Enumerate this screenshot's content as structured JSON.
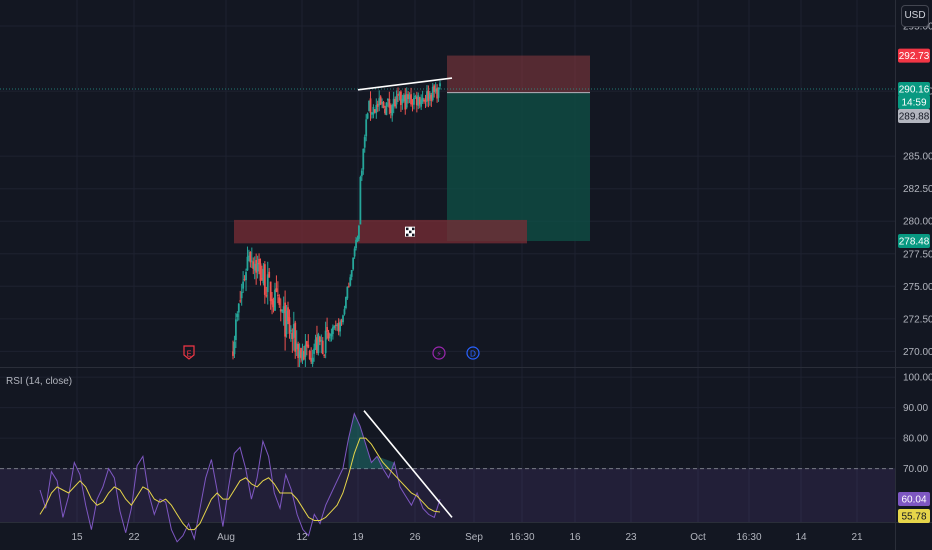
{
  "currency_button": "USD",
  "rsi_title": "RSI (14, close)",
  "colors": {
    "background": "#131722",
    "grid": "#1e2230",
    "up": "#26a69a",
    "down": "#ef5350",
    "rsi_line": "#7e57c2",
    "rsi_ma": "#e6d54a",
    "stop_zone": "#8c3a40",
    "target_zone": "#0f4d45",
    "resistance_zone": "#7a2e36"
  },
  "price_badges": {
    "stop": {
      "text": "292.73",
      "value": 292.73,
      "color": "#f23645"
    },
    "current": {
      "text": "290.16",
      "value": 290.16,
      "color": "#089981"
    },
    "countdown": {
      "text": "14:59",
      "color": "#089981"
    },
    "entry": {
      "text": "289.88",
      "value": 289.88,
      "color": "#b2b5be"
    },
    "target": {
      "text": "278.48",
      "value": 278.48,
      "color": "#089981"
    }
  },
  "rsi_badges": {
    "rsi": {
      "text": "60.04",
      "value": 60.04,
      "color": "#7e57c2"
    },
    "ma": {
      "text": "55.78",
      "value": 55.78,
      "color": "#e6d54a"
    }
  },
  "event_markers": [
    {
      "symbol": "E",
      "kind": "earnings",
      "color": "#f23645",
      "date": "Jul 31"
    },
    {
      "symbol": "⚡",
      "kind": "split",
      "color": "#9c27b0",
      "date": "Aug 26"
    },
    {
      "symbol": "D",
      "kind": "dividend",
      "color": "#2962ff",
      "date": "Aug 28"
    }
  ],
  "chart_data": [
    {
      "type": "candlestick",
      "ylim": [
        268.8,
        297.0
      ],
      "y_ticks": [
        "295.00",
        "290.00",
        "285.00",
        "282.50",
        "280.00",
        "277.50",
        "275.00",
        "272.50",
        "270.00"
      ],
      "y_tick_values": [
        295.0,
        290.0,
        285.0,
        282.5,
        280.0,
        277.5,
        275.0,
        272.5,
        270.0
      ],
      "x_ticks": [
        "15",
        "22",
        "Aug",
        "12",
        "19",
        "26",
        "Sep",
        "16:30",
        "16",
        "23",
        "Oct",
        "16:30",
        "14",
        "21"
      ],
      "segments": [
        {
          "start": 270.0,
          "end": 277.8,
          "low": 268.8,
          "high": 278.8,
          "vol": 1.0,
          "bars": 12
        },
        {
          "start": 277.8,
          "end": 269.8,
          "low": 268.8,
          "high": 279.0,
          "vol": 1.2,
          "bars": 36
        },
        {
          "start": 269.8,
          "end": 270.8,
          "low": 268.8,
          "high": 276.0,
          "vol": 1.0,
          "bars": 18
        },
        {
          "start": 270.8,
          "end": 272.2,
          "low": 268.8,
          "high": 273.5,
          "vol": 0.5,
          "bars": 10
        },
        {
          "start": 272.2,
          "end": 279.6,
          "low": 271.8,
          "high": 280.0,
          "vol": 0.35,
          "bars": 12
        },
        {
          "start": 282.2,
          "end": 288.6,
          "low": 281.8,
          "high": 289.0,
          "vol": 0.5,
          "bars": 6
        },
        {
          "start": 288.6,
          "end": 289.6,
          "low": 285.2,
          "high": 290.8,
          "vol": 0.7,
          "bars": 40
        },
        {
          "start": 289.6,
          "end": 290.0,
          "low": 288.0,
          "high": 292.0,
          "vol": 0.6,
          "bars": 8
        },
        {
          "start": 290.0,
          "end": 290.16,
          "low": 288.6,
          "high": 290.8,
          "vol": 0.5,
          "bars": 2
        }
      ],
      "position": {
        "side": "short",
        "entry": 289.88,
        "stop": 292.73,
        "target": 278.48
      },
      "resistance_zone": {
        "top": 280.1,
        "bottom": 278.3
      },
      "trendline": [
        290.1,
        291.0
      ]
    },
    {
      "type": "line",
      "title": "RSI (14, close)",
      "ylim": [
        52.5,
        103
      ],
      "y_ticks": [
        "100.00",
        "90.00",
        "80.00",
        "70.00"
      ],
      "y_tick_values": [
        100,
        90,
        80,
        70
      ],
      "overbought": 70,
      "oversold": 30,
      "series": [
        {
          "values": [
            63,
            57,
            69,
            66,
            54,
            61,
            72,
            68,
            58,
            50,
            60,
            64,
            70,
            67,
            56,
            49,
            57,
            71,
            74,
            62,
            55,
            60,
            59,
            50,
            46,
            48,
            52,
            47,
            57,
            67,
            73,
            63,
            51,
            64,
            75,
            77,
            70,
            60,
            67,
            79,
            74,
            62,
            57,
            68,
            63,
            55,
            50,
            48,
            55,
            52,
            58,
            62,
            66,
            70,
            80,
            88,
            84,
            78,
            72,
            74,
            70,
            67,
            72,
            64,
            61,
            58,
            62,
            57,
            55,
            54,
            60
          ]
        },
        {
          "values": [
            55,
            58,
            62,
            64,
            63,
            62,
            64,
            66,
            64,
            60,
            58,
            59,
            62,
            64,
            63,
            60,
            58,
            61,
            64,
            63,
            60,
            59,
            60,
            58,
            55,
            52,
            50,
            50,
            52,
            56,
            60,
            62,
            60,
            60,
            63,
            66,
            67,
            65,
            64,
            66,
            67,
            65,
            62,
            62,
            62,
            60,
            57,
            54,
            53,
            53,
            54,
            56,
            58,
            62,
            68,
            75,
            80,
            80,
            78,
            75,
            72,
            70,
            68,
            66,
            64,
            62,
            61,
            59,
            57,
            56,
            55.78
          ]
        }
      ]
    }
  ]
}
